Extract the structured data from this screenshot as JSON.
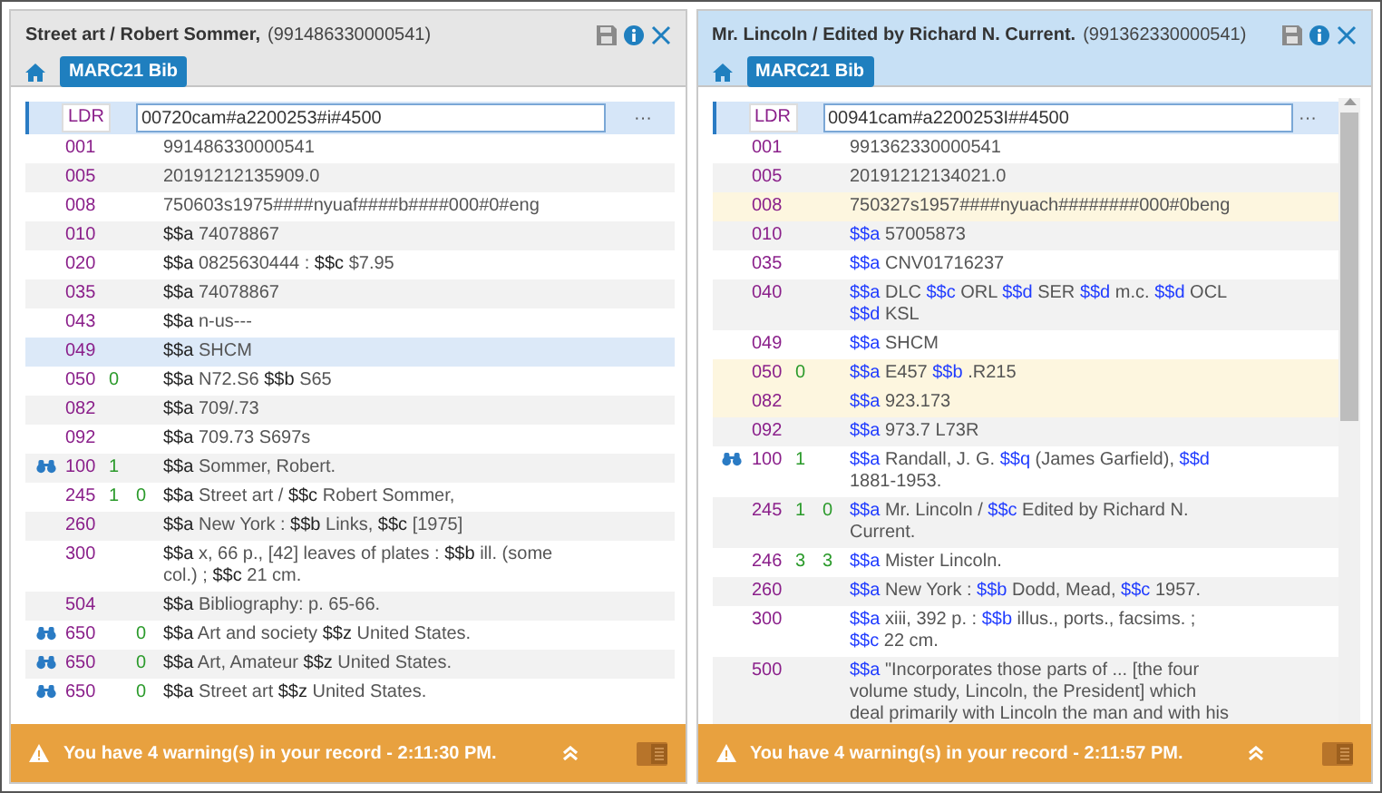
{
  "panels": [
    {
      "active": false,
      "title": "Street art / Robert Sommer,",
      "record_id": "(991486330000541)",
      "format": "MARC21 Bib",
      "leader": {
        "tag": "LDR",
        "value": "00720cam#a2200253#i#4500",
        "more": "···"
      },
      "scrollbar": false,
      "rows": [
        {
          "tag": "001",
          "ind1": "",
          "ind2": "",
          "value": "991486330000541",
          "linked": false,
          "hovered": false,
          "flagged": false
        },
        {
          "tag": "005",
          "ind1": "",
          "ind2": "",
          "value": "20191212135909.0",
          "linked": false,
          "hovered": false,
          "flagged": false
        },
        {
          "tag": "008",
          "ind1": "",
          "ind2": "",
          "value": "750603s1975####nyuaf####b####000#0#eng",
          "linked": false,
          "hovered": false,
          "flagged": false
        },
        {
          "tag": "010",
          "ind1": "",
          "ind2": "",
          "value": "$$a 74078867",
          "linked": false,
          "hovered": false,
          "flagged": false
        },
        {
          "tag": "020",
          "ind1": "",
          "ind2": "",
          "value": "$$a 0825630444 : $$c $7.95",
          "linked": false,
          "hovered": false,
          "flagged": false
        },
        {
          "tag": "035",
          "ind1": "",
          "ind2": "",
          "value": "$$a 74078867",
          "linked": false,
          "hovered": false,
          "flagged": false
        },
        {
          "tag": "043",
          "ind1": "",
          "ind2": "",
          "value": "$$a n-us---",
          "linked": false,
          "hovered": false,
          "flagged": false
        },
        {
          "tag": "049",
          "ind1": "",
          "ind2": "",
          "value": "$$a SHCM",
          "linked": false,
          "hovered": true,
          "flagged": false
        },
        {
          "tag": "050",
          "ind1": "0",
          "ind2": "",
          "value": "$$a N72.S6 $$b S65",
          "linked": false,
          "hovered": false,
          "flagged": false
        },
        {
          "tag": "082",
          "ind1": "",
          "ind2": "",
          "value": "$$a 709/.73",
          "linked": false,
          "hovered": false,
          "flagged": false
        },
        {
          "tag": "092",
          "ind1": "",
          "ind2": "",
          "value": "$$a 709.73 S697s",
          "linked": false,
          "hovered": false,
          "flagged": false
        },
        {
          "tag": "100",
          "ind1": "1",
          "ind2": "",
          "value": "$$a Sommer, Robert.",
          "linked": true,
          "hovered": false,
          "flagged": false
        },
        {
          "tag": "245",
          "ind1": "1",
          "ind2": "0",
          "value": "$$a Street art / $$c Robert Sommer,",
          "linked": false,
          "hovered": false,
          "flagged": false
        },
        {
          "tag": "260",
          "ind1": "",
          "ind2": "",
          "value": "$$a New York : $$b Links, $$c [1975]",
          "linked": false,
          "hovered": false,
          "flagged": false
        },
        {
          "tag": "300",
          "ind1": "",
          "ind2": "",
          "value": "$$a x, 66 p., [42] leaves of plates : $$b ill. (some col.) ; $$c 21 cm.",
          "linked": false,
          "hovered": false,
          "flagged": false
        },
        {
          "tag": "504",
          "ind1": "",
          "ind2": "",
          "value": "$$a Bibliography: p. 65-66.",
          "linked": false,
          "hovered": false,
          "flagged": false
        },
        {
          "tag": "650",
          "ind1": "",
          "ind2": "0",
          "value": "$$a Art and society $$z United States.",
          "linked": true,
          "hovered": false,
          "flagged": false
        },
        {
          "tag": "650",
          "ind1": "",
          "ind2": "0",
          "value": "$$a Art, Amateur $$z United States.",
          "linked": true,
          "hovered": false,
          "flagged": false
        },
        {
          "tag": "650",
          "ind1": "",
          "ind2": "0",
          "value": "$$a Street art $$z United States.",
          "linked": true,
          "hovered": false,
          "flagged": false
        }
      ],
      "footer": {
        "message": "You have 4 warning(s) in your record - 2:11:30 PM."
      }
    },
    {
      "active": true,
      "title": "Mr. Lincoln / Edited by Richard N. Current.",
      "record_id": "(991362330000541)",
      "format": "MARC21 Bib",
      "leader": {
        "tag": "LDR",
        "value": "00941cam#a2200253I##4500",
        "more": "···"
      },
      "scrollbar": true,
      "rows": [
        {
          "tag": "001",
          "ind1": "",
          "ind2": "",
          "value": "991362330000541",
          "linked": false,
          "hovered": false,
          "flagged": false
        },
        {
          "tag": "005",
          "ind1": "",
          "ind2": "",
          "value": "20191212134021.0",
          "linked": false,
          "hovered": false,
          "flagged": false
        },
        {
          "tag": "008",
          "ind1": "",
          "ind2": "",
          "value": "750327s1957####nyuach########000#0beng",
          "linked": false,
          "hovered": false,
          "flagged": true
        },
        {
          "tag": "010",
          "ind1": "",
          "ind2": "",
          "value": "$$a 57005873",
          "linked": false,
          "hovered": false,
          "flagged": false
        },
        {
          "tag": "035",
          "ind1": "",
          "ind2": "",
          "value": "$$a CNV01716237",
          "linked": false,
          "hovered": false,
          "flagged": false
        },
        {
          "tag": "040",
          "ind1": "",
          "ind2": "",
          "value": "$$a DLC $$c ORL $$d SER $$d m.c. $$d OCL $$d KSL",
          "linked": false,
          "hovered": false,
          "flagged": false
        },
        {
          "tag": "049",
          "ind1": "",
          "ind2": "",
          "value": "$$a SHCM",
          "linked": false,
          "hovered": false,
          "flagged": false
        },
        {
          "tag": "050",
          "ind1": "0",
          "ind2": "",
          "value": "$$a E457 $$b .R215",
          "linked": false,
          "hovered": false,
          "flagged": true
        },
        {
          "tag": "082",
          "ind1": "",
          "ind2": "",
          "value": "$$a 923.173",
          "linked": false,
          "hovered": false,
          "flagged": true
        },
        {
          "tag": "092",
          "ind1": "",
          "ind2": "",
          "value": "$$a 973.7 L73R",
          "linked": false,
          "hovered": false,
          "flagged": false
        },
        {
          "tag": "100",
          "ind1": "1",
          "ind2": "",
          "value": "$$a Randall, J. G. $$q (James Garfield), $$d 1881-1953.",
          "linked": true,
          "hovered": false,
          "flagged": false
        },
        {
          "tag": "245",
          "ind1": "1",
          "ind2": "0",
          "value": "$$a Mr. Lincoln / $$c Edited by Richard N. Current.",
          "linked": false,
          "hovered": false,
          "flagged": false
        },
        {
          "tag": "246",
          "ind1": "3",
          "ind2": "3",
          "value": "$$a Mister Lincoln.",
          "linked": false,
          "hovered": false,
          "flagged": false
        },
        {
          "tag": "260",
          "ind1": "",
          "ind2": "",
          "value": "$$a New York : $$b Dodd, Mead, $$c 1957.",
          "linked": false,
          "hovered": false,
          "flagged": false
        },
        {
          "tag": "300",
          "ind1": "",
          "ind2": "",
          "value": "$$a xiii, 392 p. : $$b illus., ports., facsims. ; $$c 22 cm.",
          "linked": false,
          "hovered": false,
          "flagged": false
        },
        {
          "tag": "500",
          "ind1": "",
          "ind2": "",
          "value": "$$a \"Incorporates those parts of ... [the four volume study, Lincoln, the President] which deal primarily with Lincoln the man and with his",
          "linked": false,
          "hovered": false,
          "flagged": false
        }
      ],
      "footer": {
        "message": "You have 4 warning(s) in your record - 2:11:57 PM."
      }
    }
  ]
}
